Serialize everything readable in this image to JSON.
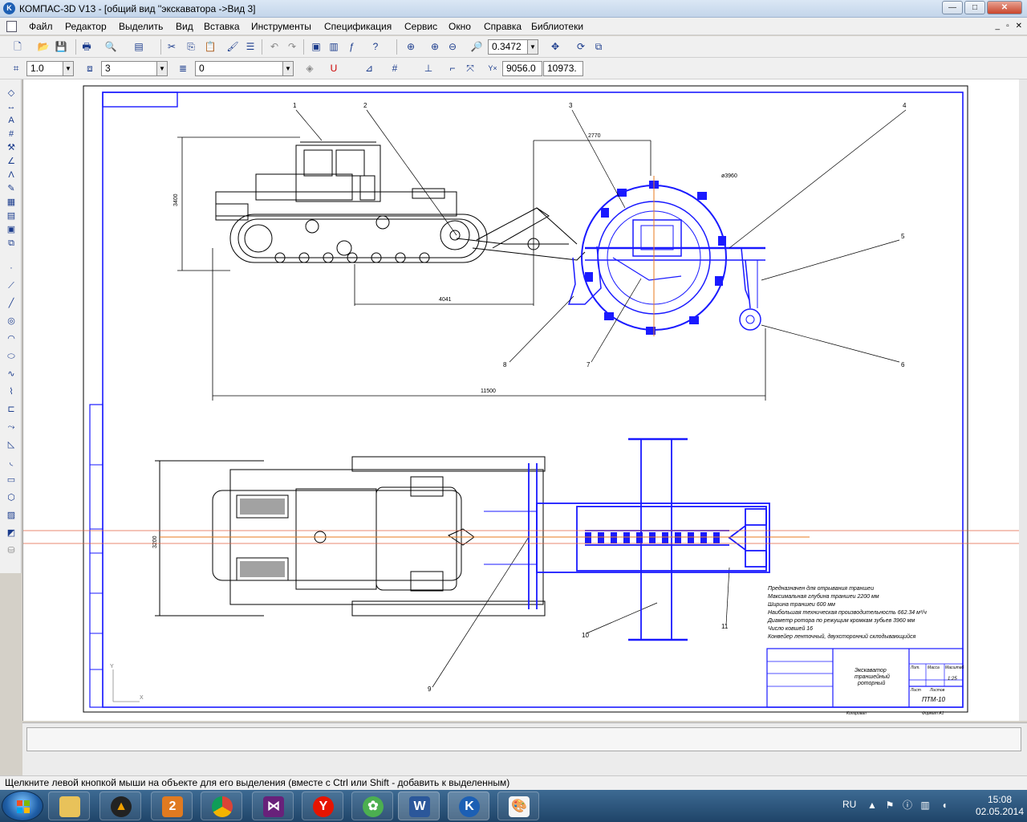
{
  "window": {
    "title": "КОМПАС-3D V13 - [общий вид ''экскаватора ->Вид 3]",
    "app_icon": "K",
    "buttons": {
      "minimize": "—",
      "maximize": "□",
      "close": "✕"
    }
  },
  "menu": {
    "items": [
      "Файл",
      "Редактор",
      "Выделить",
      "Вид",
      "Вставка",
      "Инструменты",
      "Спецификация",
      "Сервис",
      "Окно",
      "Справка",
      "Библиотеки"
    ],
    "mdi_buttons": {
      "minimize": "_",
      "restore": "▫",
      "close": "✕"
    }
  },
  "toolbar1": {
    "zoom_value": "0.3472"
  },
  "toolbar2": {
    "scale_value": "1.0",
    "layer_value": "3",
    "style_value": "0",
    "coord_x": "9056.0",
    "coord_y": "10973."
  },
  "drawing": {
    "callouts": [
      "1",
      "2",
      "3",
      "4",
      "5",
      "6",
      "7",
      "8",
      "9",
      "10",
      "11"
    ],
    "dims": {
      "height": "3400",
      "width_top": "2770",
      "diameter": "ø3960",
      "length_mid": "4041",
      "length_total": "11500",
      "plan_width": "3200"
    },
    "tech_notes": [
      "Предназначен для отрывания траншеи",
      "Максимальная глубина траншеи   2200 мм",
      "Ширина траншеи   600 мм",
      "Наибольшая техническая производительность  662.34 м³/ч",
      "Диаметр ротора по режущим кромкам зубьев  3960 мм",
      "Число ковшей  16",
      "Конвейер ленточный, двухсторонний склодывающийся"
    ],
    "title_block": {
      "name_line1": "Экскаватор",
      "name_line2": "траншейный",
      "name_line3": "роторный",
      "lit_label": "Лит.",
      "mass_label": "Масса",
      "scale_label": "Масштаб",
      "scale_value": "1:25",
      "sheet_label": "Лист",
      "sheets_label": "Листов",
      "designation": "ПТМ-10",
      "copied": "Копировал",
      "format": "Формат   А1"
    },
    "axis_labels": {
      "x": "X",
      "y": "Y"
    }
  },
  "status_text": "Щелкните левой кнопкой мыши на объекте для его выделения (вместе с Ctrl или Shift - добавить к выделенным)",
  "taskbar": {
    "apps": [
      "file-manager",
      "archicad",
      "chat-2",
      "chrome",
      "visual-studio",
      "yandex",
      "icq",
      "word",
      "kompas",
      "paint"
    ],
    "word_icon_label": "W",
    "yandex_icon_label": "Y",
    "chat_icon_label": "2",
    "tray_lang": "RU",
    "time": "15:08",
    "date": "02.05.2014"
  }
}
